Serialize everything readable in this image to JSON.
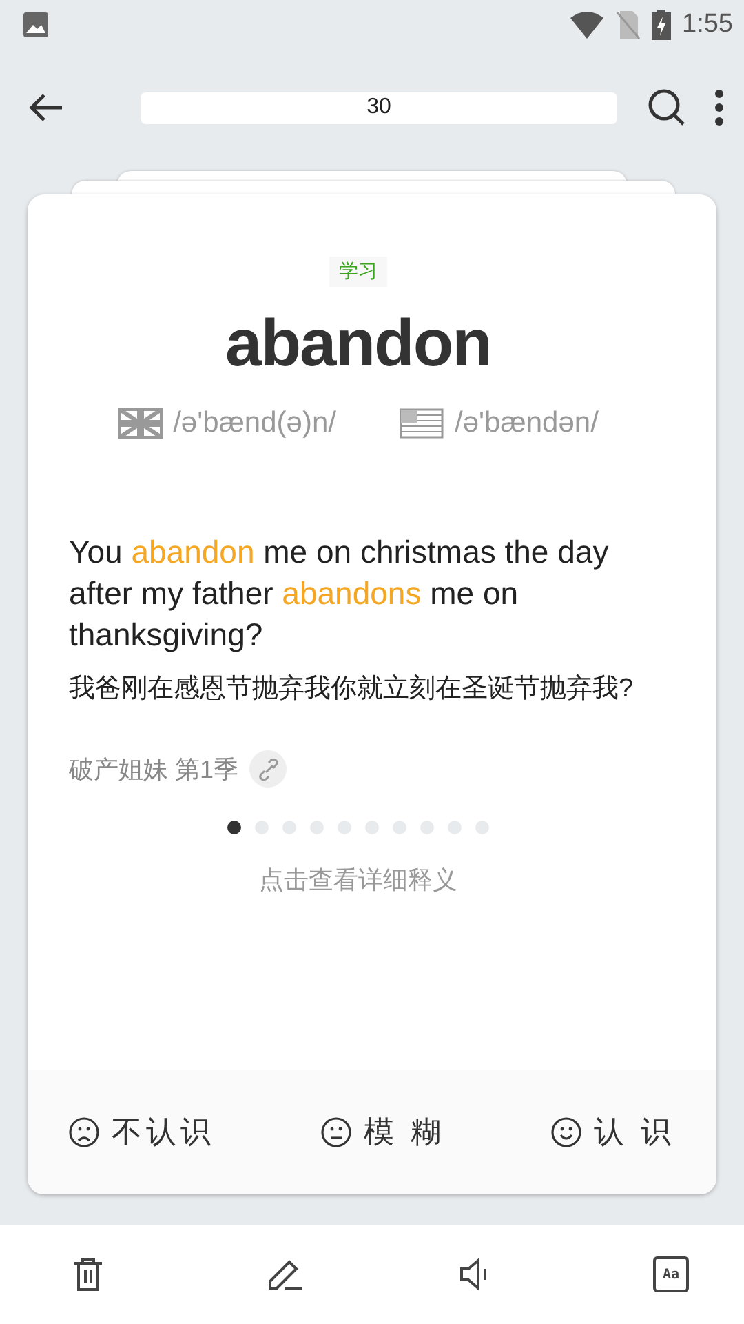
{
  "status_bar": {
    "time": "1:55"
  },
  "toolbar": {
    "counter": "30"
  },
  "card": {
    "tag": "学习",
    "word": "abandon",
    "pronunciations": [
      {
        "kind": "uk",
        "text": "/ə'bænd(ə)n/"
      },
      {
        "kind": "us",
        "text": "/ə'bændən/"
      }
    ],
    "sentence": [
      {
        "text": "You ",
        "highlight": false
      },
      {
        "text": "abandon",
        "highlight": true
      },
      {
        "text": " me on christmas the day after my father ",
        "highlight": false
      },
      {
        "text": "abandons",
        "highlight": true
      },
      {
        "text": " me on thanksgiving?",
        "highlight": false
      }
    ],
    "translation": "我爸刚在感恩节抛弃我你就立刻在圣诞节抛弃我?",
    "source": "破产姐妹 第1季",
    "pager": [
      {
        "selected": true
      },
      {
        "selected": false
      },
      {
        "selected": false
      },
      {
        "selected": false
      },
      {
        "selected": false
      },
      {
        "selected": false
      },
      {
        "selected": false
      },
      {
        "selected": false
      },
      {
        "selected": false
      },
      {
        "selected": false
      }
    ],
    "detail_hint": "点击查看详细释义",
    "answers": [
      {
        "kind": "sad",
        "label": "不认识"
      },
      {
        "kind": "neutral",
        "label": "模 糊"
      },
      {
        "kind": "happy",
        "label": "认 识"
      }
    ]
  },
  "bottom_bar": [
    {
      "kind": "delete"
    },
    {
      "kind": "edit"
    },
    {
      "kind": "sound"
    },
    {
      "kind": "font",
      "label": "Aa"
    }
  ]
}
